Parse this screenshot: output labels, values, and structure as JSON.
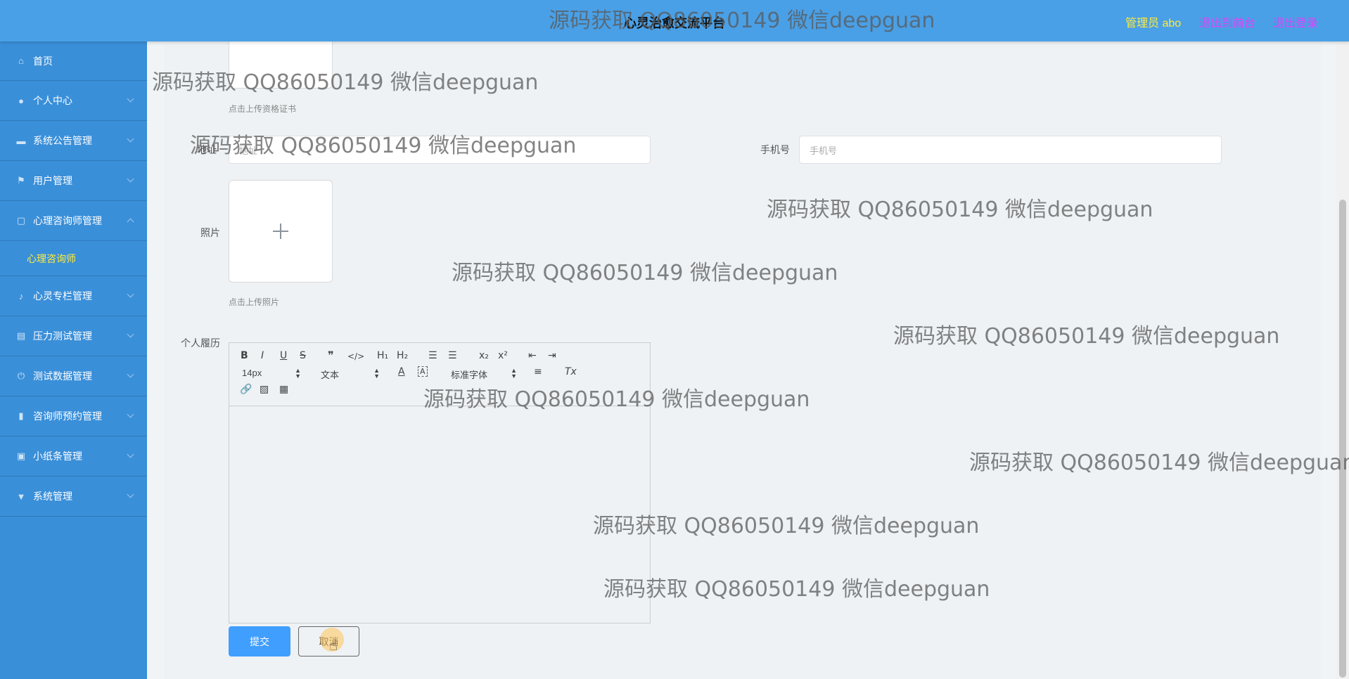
{
  "header": {
    "title": "心灵治愈交流平台",
    "admin_label": "管理员 abo",
    "to_front_label": "退出到前台",
    "logout_label": "退出登录"
  },
  "sidebar": {
    "items": [
      {
        "label": "首页",
        "icon": "home-icon"
      },
      {
        "label": "个人中心",
        "icon": "user-icon"
      },
      {
        "label": "系统公告管理",
        "icon": "card-icon"
      },
      {
        "label": "用户管理",
        "icon": "flag-icon"
      },
      {
        "label": "心理咨询师管理",
        "icon": "square-icon"
      },
      {
        "label": "心灵专栏管理",
        "icon": "microphone-icon"
      },
      {
        "label": "压力测试管理",
        "icon": "briefcase-icon"
      },
      {
        "label": "测试数据管理",
        "icon": "power-icon"
      },
      {
        "label": "咨询师预约管理",
        "icon": "bar-chart-icon"
      },
      {
        "label": "小纸条管理",
        "icon": "note-icon"
      },
      {
        "label": "系统管理",
        "icon": "cup-icon"
      }
    ],
    "submenu_label": "心理咨询师"
  },
  "form": {
    "cert_hint": "点击上传资格证书",
    "address_label": "地址",
    "address_placeholder": "地址",
    "phone_label": "手机号",
    "phone_placeholder": "手机号",
    "photo_label": "照片",
    "photo_hint": "点击上传照片",
    "resume_label": "个人履历",
    "submit_label": "提交",
    "cancel_label": "取消"
  },
  "editor": {
    "font_size": "14px",
    "text_style": "文本",
    "font_family": "标准字体",
    "buttons": {
      "bold": "B",
      "italic": "I",
      "underline": "U",
      "strike": "S",
      "quote": "❞",
      "code": "</>",
      "h1": "H₁",
      "h2": "H₂",
      "subscript": "x₂",
      "superscript": "x²",
      "color": "A",
      "background": "A",
      "clean": "Tx"
    }
  },
  "watermark": "源码获取 QQ86050149 微信deepguan"
}
